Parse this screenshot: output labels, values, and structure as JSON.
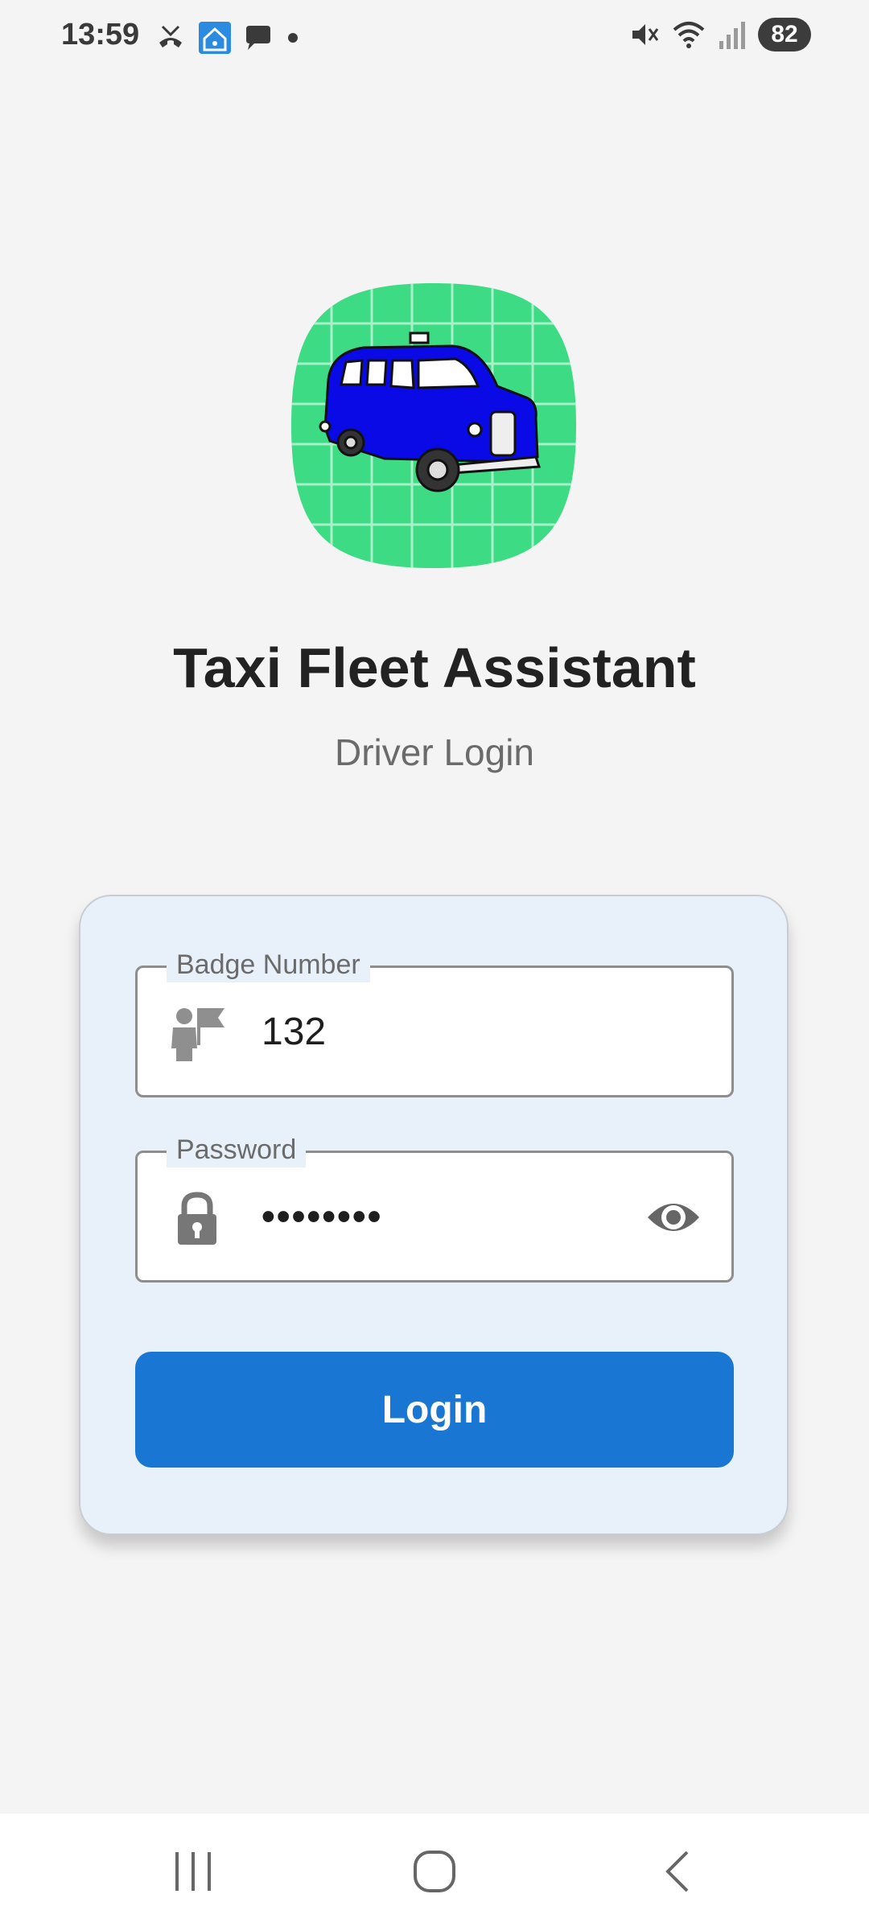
{
  "status_bar": {
    "time": "13:59",
    "battery": "82",
    "left_icons": [
      "missed-call-icon",
      "home-wifi-icon",
      "message-icon",
      "notification-dot-icon"
    ],
    "right_icons": [
      "mute-icon",
      "wifi-icon",
      "signal-icon"
    ]
  },
  "app": {
    "title": "Taxi Fleet Assistant",
    "subtitle": "Driver Login",
    "logo_icon": "taxi-logo-icon",
    "logo_bg_color": "#3ddc84",
    "taxi_color": "#0a0ae6"
  },
  "form": {
    "badge": {
      "label": "Badge Number",
      "value": "132",
      "icon": "driver-flag-icon"
    },
    "password": {
      "label": "Password",
      "value": "••••••••",
      "icon": "lock-icon",
      "toggle_icon": "eye-icon"
    },
    "login_button": "Login",
    "accent_color": "#1976d2"
  },
  "nav_bar": {
    "recents_icon": "recents-icon",
    "home_icon": "home-icon",
    "back_icon": "back-icon"
  }
}
